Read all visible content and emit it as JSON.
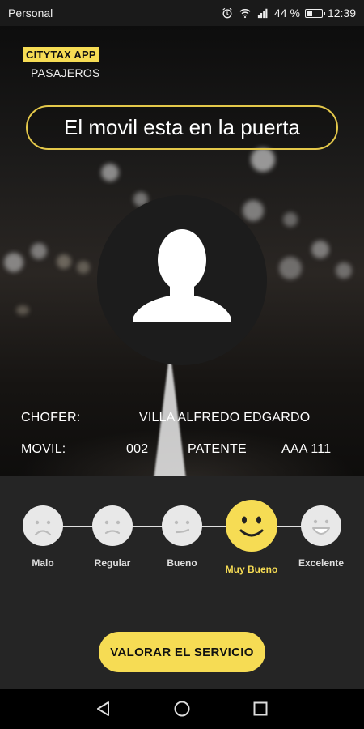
{
  "status_bar": {
    "carrier": "Personal",
    "battery_percent": "44 %",
    "battery_level": 0.44,
    "time": "12:39",
    "icons": [
      "alarm-icon",
      "wifi-icon",
      "signal-icon",
      "battery-icon"
    ]
  },
  "brand": {
    "name": "CITYTAX APP",
    "subtitle": "PASAJEROS"
  },
  "notice": "El movil esta en la puerta",
  "driver": {
    "chofer_label": "CHOFER:",
    "chofer_name": "VILLA ALFREDO EDGARDO",
    "movil_label": "MOVIL:",
    "movil_value": "002",
    "patente_label": "PATENTE",
    "patente_value": "AAA 111"
  },
  "rating": {
    "options": [
      {
        "label": "Malo",
        "icon": "very-sad-face-icon"
      },
      {
        "label": "Regular",
        "icon": "sad-face-icon"
      },
      {
        "label": "Bueno",
        "icon": "neutral-face-icon"
      },
      {
        "label": "Muy Bueno",
        "icon": "happy-face-icon"
      },
      {
        "label": "Excelente",
        "icon": "laughing-face-icon"
      }
    ],
    "selected_index": 3,
    "submit_label": "VALORAR EL SERVICIO"
  },
  "colors": {
    "accent": "#f6dc54",
    "background": "#252525"
  }
}
